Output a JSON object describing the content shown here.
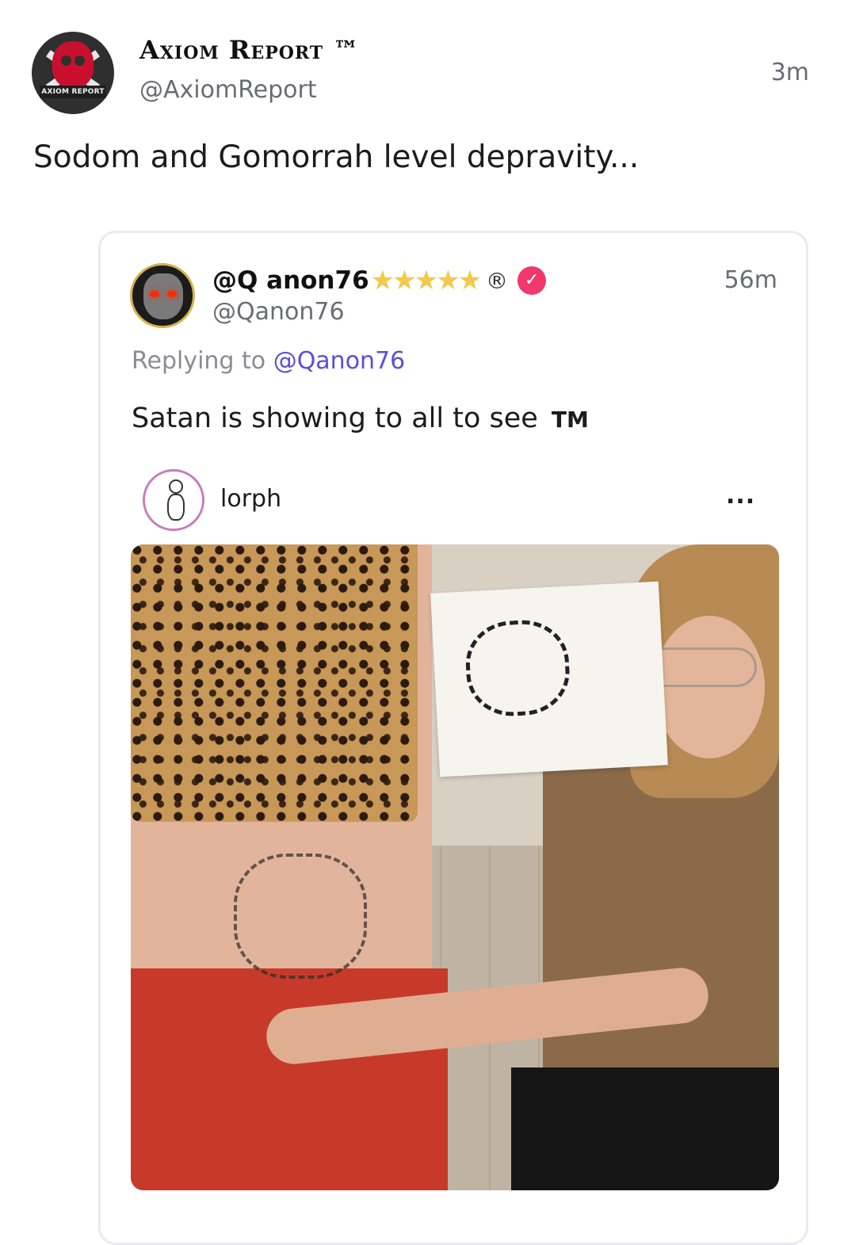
{
  "post": {
    "author_name": "Axiom Report ™",
    "author_handle": "@AxiomReport",
    "time": "3m",
    "avatar_badge_text": "AXIOM REPORT",
    "text": "Sodom and Gomorrah level depravity..."
  },
  "quote": {
    "name": "@Q anon76",
    "stars": "★★★★★",
    "registered": "®",
    "verified_icon": "verified-badge-icon",
    "handle": "@Qanon76",
    "time": "56m",
    "reply_prefix": "Replying to",
    "reply_mention": "@Qanon76",
    "text": "Satan is showing to all to see",
    "tm": "TM"
  },
  "embed": {
    "username": "lorph",
    "more": "...",
    "image_description": "photo"
  },
  "colors": {
    "mention": "#5a4fd6",
    "verified": "#f0386b",
    "stars": "#f2c94c",
    "muted": "#6b6b78"
  }
}
